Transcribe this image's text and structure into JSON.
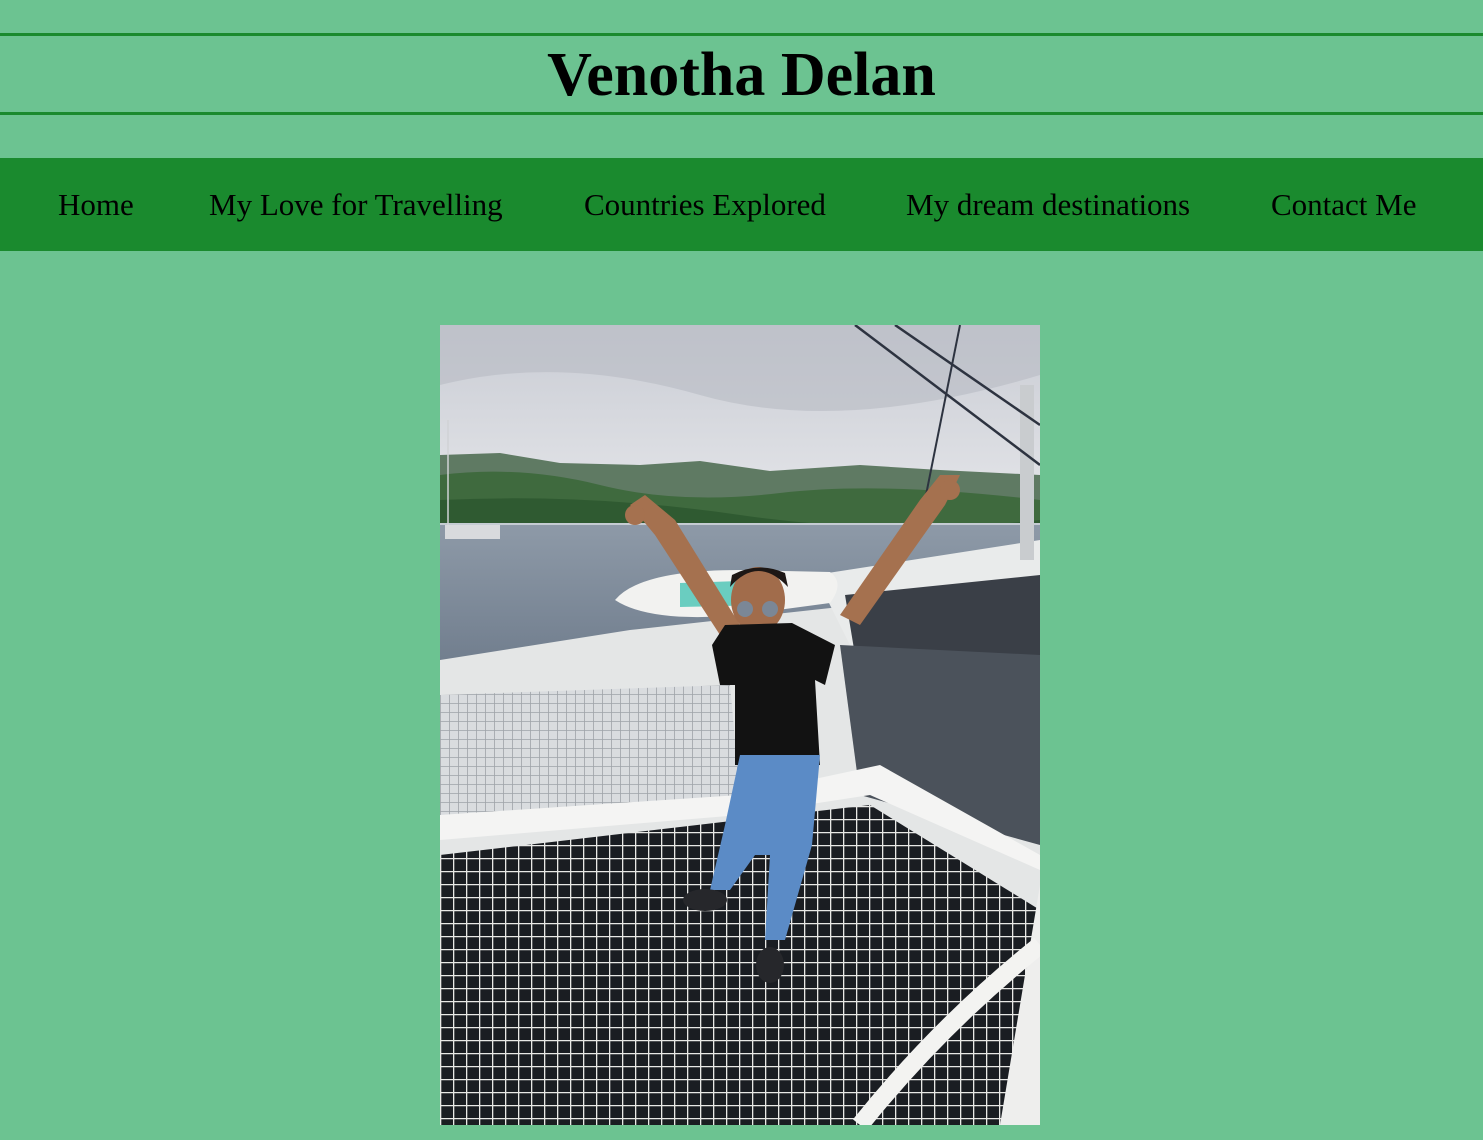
{
  "header": {
    "title": "Venotha Delan"
  },
  "nav": {
    "items": [
      {
        "label": "Home"
      },
      {
        "label": "My Love for Travelling"
      },
      {
        "label": "Countries Explored"
      },
      {
        "label": "My dream destinations"
      },
      {
        "label": "Contact Me"
      }
    ]
  },
  "colors": {
    "page_background": "#6cc391",
    "nav_background": "#1a8a2e",
    "header_rule": "#1a8a2e",
    "text": "#000000"
  }
}
